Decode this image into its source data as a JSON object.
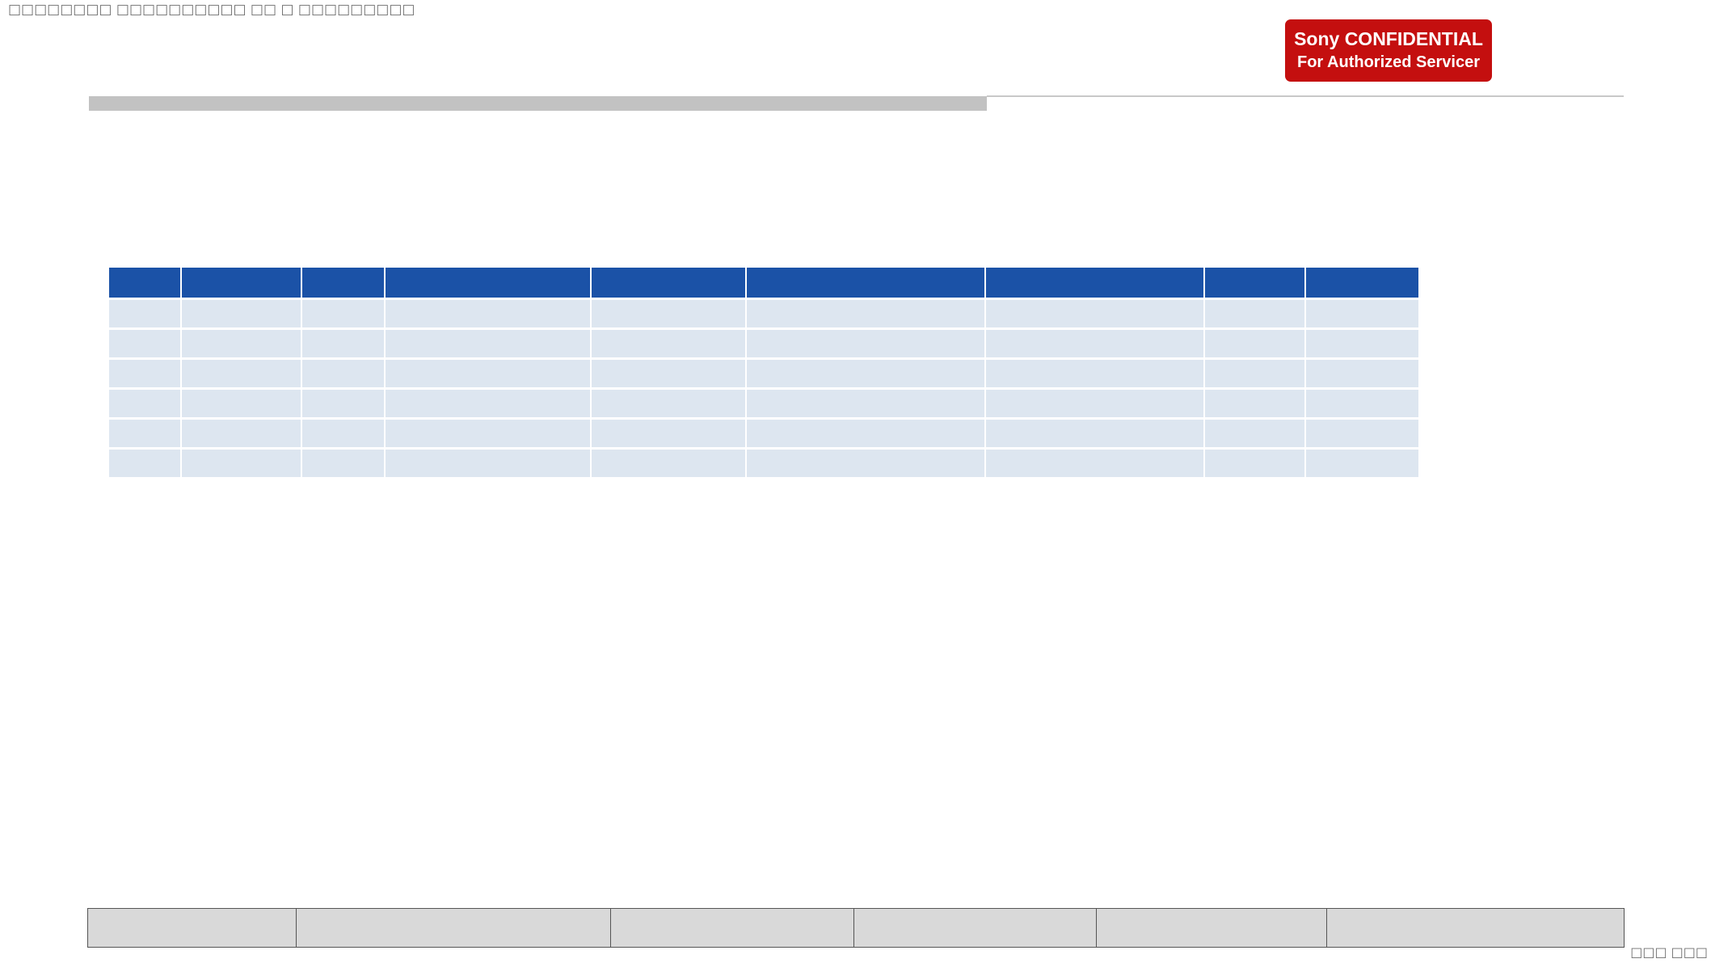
{
  "header": {
    "garbled_text": "□□□□□□□□ □□□□□□□□□□ □□ □ □□□□□□□□□"
  },
  "badge": {
    "line1": "Sony CONFIDENTIAL",
    "line2": "For Authorized Servicer",
    "color": "#c40f0f"
  },
  "spec_table": {
    "header_color": "#1b52a7",
    "row_color": "#dde6f0",
    "column_count": 9,
    "row_count": 6
  },
  "footer_table": {
    "cell_count": 6
  },
  "page_number": "□□□ □□□"
}
